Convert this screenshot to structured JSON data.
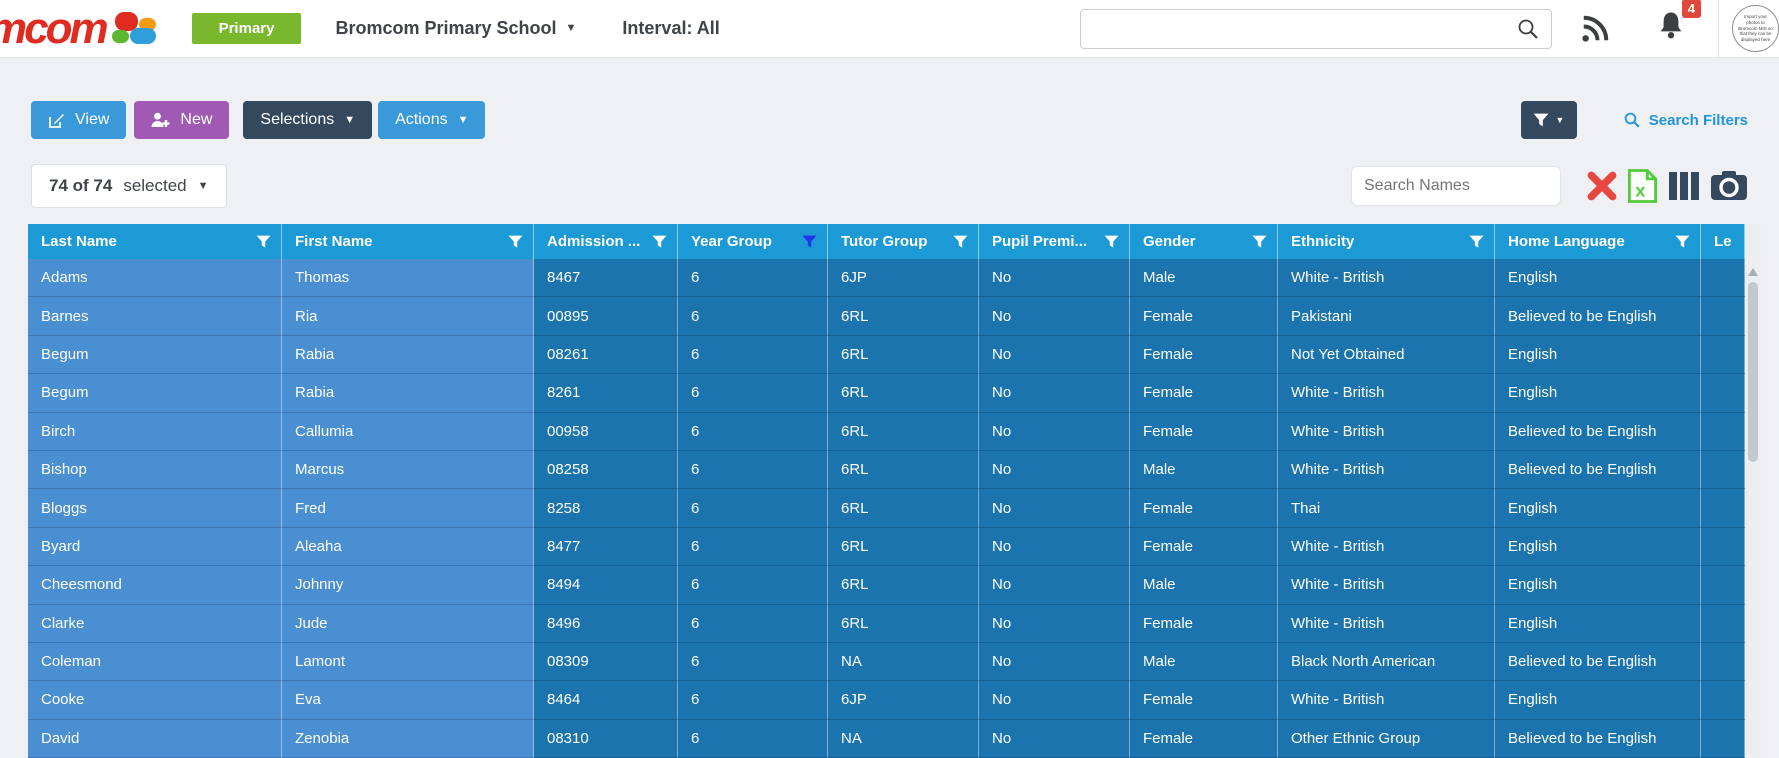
{
  "header": {
    "logo_text": "mcom",
    "badge": "Primary",
    "school_name": "Bromcom Primary School",
    "interval_label": "Interval: All",
    "global_search_value": "",
    "notification_count": "4",
    "avatar_text": "Import your photos to Bromcom MIS so that they can be displayed here"
  },
  "toolbar": {
    "view_label": "View",
    "new_label": "New",
    "selections_label": "Selections",
    "actions_label": "Actions",
    "search_filters_label": "Search Filters"
  },
  "selection_bar": {
    "count_label": "74 of 74",
    "selected_label": "selected",
    "search_names_placeholder": "Search Names"
  },
  "table": {
    "columns": [
      {
        "label": "Last Name",
        "filter_active": false
      },
      {
        "label": "First Name",
        "filter_active": false
      },
      {
        "label": "Admission ...",
        "filter_active": false
      },
      {
        "label": "Year Group",
        "filter_active": true
      },
      {
        "label": "Tutor Group",
        "filter_active": false
      },
      {
        "label": "Pupil Premi...",
        "filter_active": false
      },
      {
        "label": "Gender",
        "filter_active": false
      },
      {
        "label": "Ethnicity",
        "filter_active": false
      },
      {
        "label": "Home Language",
        "filter_active": false
      },
      {
        "label": "Le",
        "filter_active": false
      }
    ],
    "rows": [
      [
        "Adams",
        "Thomas",
        "8467",
        "6",
        "6JP",
        "No",
        "Male",
        "White - British",
        "English"
      ],
      [
        "Barnes",
        "Ria",
        "00895",
        "6",
        "6RL",
        "No",
        "Female",
        "Pakistani",
        "Believed to be English"
      ],
      [
        "Begum",
        "Rabia",
        "08261",
        "6",
        "6RL",
        "No",
        "Female",
        "Not Yet Obtained",
        "English"
      ],
      [
        "Begum",
        "Rabia",
        "8261",
        "6",
        "6RL",
        "No",
        "Female",
        "White - British",
        "English"
      ],
      [
        "Birch",
        "Callumia",
        "00958",
        "6",
        "6RL",
        "No",
        "Female",
        "White - British",
        "Believed to be English"
      ],
      [
        "Bishop",
        "Marcus",
        "08258",
        "6",
        "6RL",
        "No",
        "Male",
        "White - British",
        "Believed to be English"
      ],
      [
        "Bloggs",
        "Fred",
        "8258",
        "6",
        "6RL",
        "No",
        "Female",
        "Thai",
        "English"
      ],
      [
        "Byard",
        "Aleaha",
        "8477",
        "6",
        "6RL",
        "No",
        "Female",
        "White - British",
        "English"
      ],
      [
        "Cheesmond",
        "Johnny",
        "8494",
        "6",
        "6RL",
        "No",
        "Male",
        "White - British",
        "English"
      ],
      [
        "Clarke",
        "Jude",
        "8496",
        "6",
        "6RL",
        "No",
        "Female",
        "White - British",
        "English"
      ],
      [
        "Coleman",
        "Lamont",
        "08309",
        "6",
        "NA",
        "No",
        "Male",
        "Black North American",
        "Believed to be English"
      ],
      [
        "Cooke",
        "Eva",
        "8464",
        "6",
        "6JP",
        "No",
        "Female",
        "White - British",
        "English"
      ],
      [
        "David",
        "Zenobia",
        "08310",
        "6",
        "NA",
        "No",
        "Female",
        "Other Ethnic Group",
        "Believed to be English"
      ]
    ]
  },
  "colors": {
    "c_brand_red": "#e02b20",
    "c_badge_green": "#79b72d",
    "c_blue_btn": "#3a99d8",
    "c_purple_btn": "#a05ab3",
    "c_dark_btn": "#34495e",
    "c_link": "#2196d8",
    "c_head": "#1b9ad5",
    "c_frozen": "#4a8fd1",
    "c_cell": "#1b74ad",
    "c_filter_active": "#2233ee",
    "c_red": "#e8473f",
    "c_excel": "#52cc3a",
    "c_icon_dark": "#3c3f41",
    "c_badge_red": "#e0483c"
  }
}
